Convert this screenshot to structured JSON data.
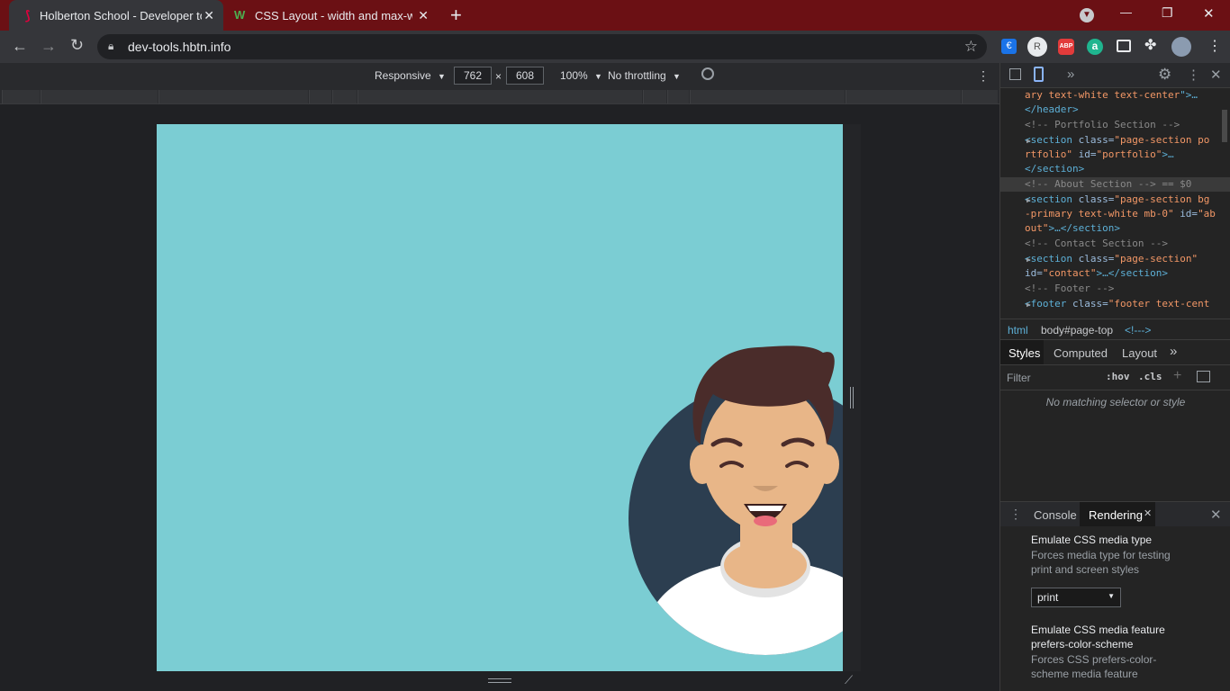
{
  "tabs": [
    {
      "title": "Holberton School - Developer tools",
      "active": true
    },
    {
      "title": "CSS Layout - width and max-width",
      "active": false
    }
  ],
  "new_tab": "+",
  "window_controls": {
    "minimize": "—",
    "maximize": "❐",
    "close": "✕"
  },
  "omnibox": {
    "url": "dev-tools.hbtn.info"
  },
  "extensions": [
    "euro-icon",
    "profile-r-icon",
    "adblock-icon",
    "a-icon",
    "media-icon",
    "puzzle-icon",
    "avatar"
  ],
  "extension_labels": {
    "abp": "ABP",
    "a": "a",
    "euro": "€"
  },
  "device_toolbar": {
    "mode": "Responsive",
    "width": "762",
    "times": "×",
    "height": "608",
    "zoom": "100%",
    "throttling": "No throttling"
  },
  "elements_panel": {
    "lines": [
      {
        "parts": [
          {
            "c": "val",
            "t": "ary text-white text-center"
          },
          {
            "c": "tag",
            "t": "\">…"
          }
        ]
      },
      {
        "parts": [
          {
            "c": "tag",
            "t": "</header>"
          }
        ]
      },
      {
        "parts": [
          {
            "c": "cmt",
            "t": "  <!-- Portfolio Section -->"
          }
        ]
      },
      {
        "parts": [
          {
            "c": "tag",
            "t": "<section "
          },
          {
            "c": "attr",
            "t": "class="
          },
          {
            "c": "val",
            "t": "\"page-section po"
          }
        ]
      },
      {
        "parts": [
          {
            "c": "val",
            "t": "rtfolio\" "
          },
          {
            "c": "attr",
            "t": "id="
          },
          {
            "c": "val",
            "t": "\"portfolio\""
          },
          {
            "c": "tag",
            "t": ">…"
          }
        ]
      },
      {
        "parts": [
          {
            "c": "tag",
            "t": "</section>"
          }
        ]
      },
      {
        "parts": [
          {
            "c": "cmt",
            "t": "  <!-- About Section --> == $0"
          }
        ]
      },
      {
        "parts": [
          {
            "c": "tag",
            "t": "<section "
          },
          {
            "c": "attr",
            "t": "class="
          },
          {
            "c": "val",
            "t": "\"page-section bg"
          }
        ]
      },
      {
        "parts": [
          {
            "c": "val",
            "t": "-primary text-white mb-0\" "
          },
          {
            "c": "attr",
            "t": "id="
          },
          {
            "c": "val",
            "t": "\"ab"
          }
        ]
      },
      {
        "parts": [
          {
            "c": "val",
            "t": "out\""
          },
          {
            "c": "tag",
            "t": ">…</section>"
          }
        ]
      },
      {
        "parts": [
          {
            "c": "cmt",
            "t": "  <!-- Contact Section -->"
          }
        ]
      },
      {
        "parts": [
          {
            "c": "tag",
            "t": "<section "
          },
          {
            "c": "attr",
            "t": "class="
          },
          {
            "c": "val",
            "t": "\"page-section\""
          }
        ]
      },
      {
        "parts": [
          {
            "c": "attr",
            "t": "id="
          },
          {
            "c": "val",
            "t": "\"contact\""
          },
          {
            "c": "tag",
            "t": ">…</section>"
          }
        ]
      },
      {
        "parts": [
          {
            "c": "cmt",
            "t": "  <!-- Footer -->"
          }
        ]
      },
      {
        "parts": [
          {
            "c": "tag",
            "t": "<footer "
          },
          {
            "c": "attr",
            "t": "class="
          },
          {
            "c": "val",
            "t": "\"footer text-cent"
          }
        ]
      }
    ]
  },
  "breadcrumb": [
    "html",
    "body#page-top",
    "<!--->"
  ],
  "styles_tabs": [
    "Styles",
    "Computed",
    "Layout",
    "»"
  ],
  "filter": {
    "placeholder": "Filter",
    "hov": ":hov",
    "cls": ".cls",
    "plus": "+"
  },
  "no_match": "No matching selector or style",
  "drawer_tabs": [
    "Console",
    "Rendering"
  ],
  "rendering": {
    "media_type_title": "Emulate CSS media type",
    "media_type_desc": "Forces media type for testing print and screen styles",
    "media_type_value": "print",
    "feature_title": "Emulate CSS media feature prefers-color-scheme",
    "feature_desc": "Forces CSS prefers-color-scheme media feature"
  },
  "colors": {
    "page_bg": "#7bcdd3",
    "tab_strip": "#6b1014",
    "circle": "#2c3e50"
  }
}
